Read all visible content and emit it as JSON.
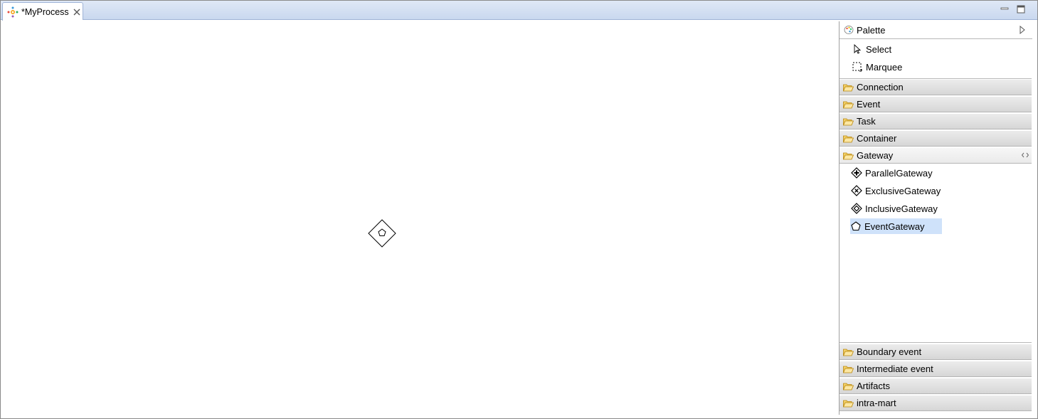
{
  "editor": {
    "tab_title": "*MyProcess"
  },
  "palette": {
    "title": "Palette",
    "tools": [
      {
        "label": "Select"
      },
      {
        "label": "Marquee"
      }
    ],
    "drawers": {
      "connection": "Connection",
      "event": "Event",
      "task": "Task",
      "container": "Container",
      "gateway": "Gateway",
      "boundary_event": "Boundary event",
      "intermediate_event": "Intermediate event",
      "artifacts": "Artifacts",
      "intra_mart": "intra-mart"
    },
    "gateway_entries": [
      {
        "label": "ParallelGateway",
        "icon": "parallel-gateway-icon"
      },
      {
        "label": "ExclusiveGateway",
        "icon": "exclusive-gateway-icon"
      },
      {
        "label": "InclusiveGateway",
        "icon": "inclusive-gateway-icon"
      },
      {
        "label": "EventGateway",
        "icon": "event-gateway-icon",
        "selected": true
      }
    ]
  },
  "colors": {
    "selection": "#cfe2fa",
    "folder": "#f0c34a",
    "tab_strip": "#c9d8ef"
  }
}
